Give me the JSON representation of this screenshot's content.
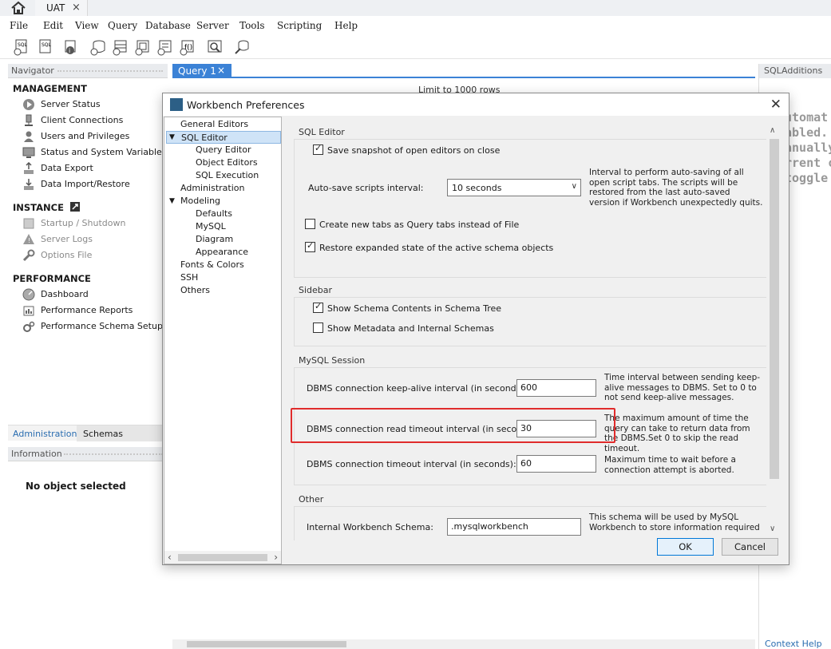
{
  "connection_tab": {
    "label": "UAT",
    "close": "×"
  },
  "menu": [
    "File",
    "Edit",
    "View",
    "Query",
    "Database",
    "Server",
    "Tools",
    "Scripting",
    "Help"
  ],
  "navigator": {
    "header": "Navigator",
    "management": {
      "title": "MANAGEMENT",
      "items": [
        "Server Status",
        "Client Connections",
        "Users and Privileges",
        "Status and System Variables",
        "Data Export",
        "Data Import/Restore"
      ]
    },
    "instance": {
      "title": "INSTANCE",
      "items": [
        "Startup / Shutdown",
        "Server Logs",
        "Options File"
      ]
    },
    "performance": {
      "title": "PERFORMANCE",
      "items": [
        "Dashboard",
        "Performance Reports",
        "Performance Schema Setup"
      ]
    },
    "tabs": [
      "Administration",
      "Schemas"
    ],
    "info_header": "Information",
    "no_object": "No object selected"
  },
  "query_tab": {
    "label": "Query 1",
    "close": "×"
  },
  "limit_select": "Limit to 1000 rows",
  "right_panel": {
    "header": "SQLAdditions",
    "help_text": "utomat\nabled.\nanually\nrrent ca\ntoggle a",
    "context_help": "Context Help"
  },
  "dialog": {
    "title": "Workbench Preferences",
    "close": "✕",
    "tree": [
      {
        "label": "General Editors",
        "level": 0
      },
      {
        "label": "SQL Editor",
        "level": 0,
        "expanded": true,
        "selected": true
      },
      {
        "label": "Query Editor",
        "level": 1
      },
      {
        "label": "Object Editors",
        "level": 1
      },
      {
        "label": "SQL Execution",
        "level": 1
      },
      {
        "label": "Administration",
        "level": 0
      },
      {
        "label": "Modeling",
        "level": 0,
        "expanded": true
      },
      {
        "label": "Defaults",
        "level": 1
      },
      {
        "label": "MySQL",
        "level": 1
      },
      {
        "label": "Diagram",
        "level": 1
      },
      {
        "label": "Appearance",
        "level": 1
      },
      {
        "label": "Fonts & Colors",
        "level": 0
      },
      {
        "label": "SSH",
        "level": 0
      },
      {
        "label": "Others",
        "level": 0
      }
    ],
    "sql_editor": {
      "section": "SQL Editor",
      "save_snapshot": "Save snapshot of open editors on close",
      "autosave_label": "Auto-save scripts interval:",
      "autosave_value": "10 seconds",
      "autosave_desc": "Interval to perform auto-saving of all open script tabs. The scripts will be restored from the last auto-saved version if Workbench unexpectedly quits.",
      "new_tabs": "Create new tabs as Query tabs instead of File",
      "restore_state": "Restore expanded state of the active schema objects"
    },
    "sidebar": {
      "section": "Sidebar",
      "show_schema": "Show Schema Contents in Schema Tree",
      "show_metadata": "Show Metadata and Internal Schemas"
    },
    "session": {
      "section": "MySQL Session",
      "keepalive_label": "DBMS connection keep-alive interval (in seconds):",
      "keepalive_value": "600",
      "keepalive_desc": "Time interval between sending keep-alive messages to DBMS. Set to 0 to not send keep-alive messages.",
      "read_timeout_label": "DBMS connection read timeout interval (in seconds):",
      "read_timeout_value": "30",
      "read_timeout_desc": "The maximum amount of time the query can take to return data from the DBMS.Set 0 to skip the read timeout.",
      "conn_timeout_label": "DBMS connection timeout interval (in seconds):",
      "conn_timeout_value": "60",
      "conn_timeout_desc": "Maximum time to wait before a connection attempt is aborted."
    },
    "other": {
      "section": "Other",
      "schema_label": "Internal Workbench Schema:",
      "schema_value": ".mysqlworkbench",
      "schema_desc": "This schema will be used by MySQL Workbench to store information required"
    },
    "ok": "OK",
    "cancel": "Cancel"
  },
  "colors": {
    "accent": "#3b82d6",
    "highlight": "#e02b2b"
  }
}
